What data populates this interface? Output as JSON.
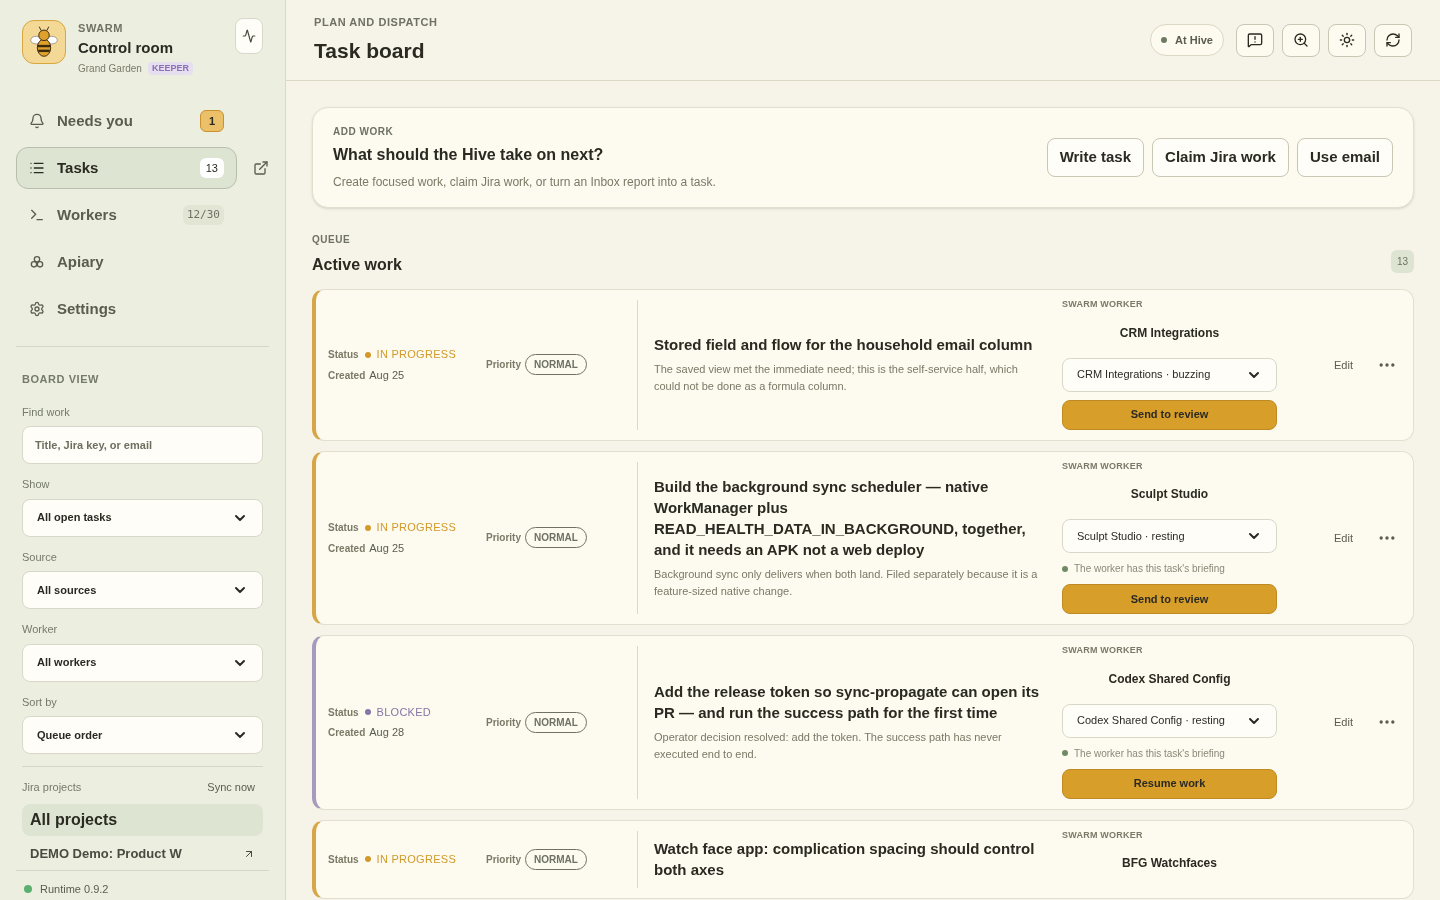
{
  "brand": {
    "eyebrow": "SWARM",
    "title": "Control room",
    "org": "Grand Garden",
    "role": "KEEPER"
  },
  "nav": [
    {
      "label": "Needs you",
      "badge": {
        "text": "1",
        "kind": "alert"
      },
      "selected": false
    },
    {
      "label": "Tasks",
      "badge": {
        "text": "13",
        "kind": "count"
      },
      "selected": true
    },
    {
      "label": "Workers",
      "badge": {
        "text": "12/30",
        "kind": "ratio"
      },
      "selected": false
    },
    {
      "label": "Apiary",
      "selected": false
    },
    {
      "label": "Settings",
      "selected": false
    }
  ],
  "board_view": {
    "heading": "BOARD VIEW",
    "search": {
      "label": "Find work",
      "placeholder": "Title, Jira key, or email"
    },
    "filters": [
      {
        "label": "Show",
        "value": "All open tasks"
      },
      {
        "label": "Source",
        "value": "All sources"
      },
      {
        "label": "Worker",
        "value": "All workers"
      },
      {
        "label": "Sort by",
        "value": "Queue order"
      }
    ],
    "jira": {
      "label": "Jira projects",
      "action": "Sync now"
    },
    "projects": [
      {
        "label": "All projects",
        "selected": true
      },
      {
        "label": "DEMO Demo: Product W",
        "selected": false
      }
    ]
  },
  "runtime": "Runtime 0.9.2",
  "header": {
    "eyebrow": "PLAN AND DISPATCH",
    "title": "Task board",
    "presence": "At Hive"
  },
  "add_work": {
    "eyebrow": "ADD WORK",
    "title": "What should the Hive take on next?",
    "description": "Create focused work, claim Jira work, or turn an Inbox report into a task.",
    "buttons": [
      "Write task",
      "Claim Jira work",
      "Use email"
    ]
  },
  "queue": {
    "eyebrow": "QUEUE",
    "title": "Active work",
    "count": "13"
  },
  "tasks": [
    {
      "status_label": "Status",
      "status": "IN PROGRESS",
      "kind": "in_progress",
      "priority_label": "Priority",
      "priority": "NORMAL",
      "created_label": "Created",
      "created": "Aug 25",
      "title": "Stored field and flow for the household email column",
      "description": "The saved view met the immediate need; this is the self-service half, which could not be done as a formula column.",
      "worker_label": "SWARM WORKER",
      "worker": "CRM Integrations",
      "assignee": "CRM Integrations · buzzing",
      "action": "Send to review",
      "edit": "Edit"
    },
    {
      "status_label": "Status",
      "status": "IN PROGRESS",
      "kind": "in_progress",
      "priority_label": "Priority",
      "priority": "NORMAL",
      "created_label": "Created",
      "created": "Aug 25",
      "title": "Build the background sync scheduler — native WorkManager plus READ_HEALTH_DATA_IN_BACKGROUND, together, and it needs an APK not a web deploy",
      "description": "Background sync only delivers when both land. Filed separately because it is a feature-sized native change.",
      "worker_label": "SWARM WORKER",
      "worker": "Sculpt Studio",
      "assignee": "Sculpt Studio · resting",
      "briefing": "The worker has this task's briefing",
      "action": "Send to review",
      "edit": "Edit"
    },
    {
      "status_label": "Status",
      "status": "BLOCKED",
      "kind": "blocked",
      "priority_label": "Priority",
      "priority": "NORMAL",
      "created_label": "Created",
      "created": "Aug 28",
      "title": "Add the release token so sync-propagate can open its PR — and run the success path for the first time",
      "description": "Operator decision resolved: add the token. The success path has never executed end to end.",
      "worker_label": "SWARM WORKER",
      "worker": "Codex Shared Config",
      "assignee": "Codex Shared Config · resting",
      "briefing": "The worker has this task's briefing",
      "action": "Resume work",
      "edit": "Edit"
    },
    {
      "status_label": "Status",
      "status": "IN PROGRESS",
      "kind": "in_progress",
      "priority_label": "Priority",
      "priority": "NORMAL",
      "title": "Watch face app: complication spacing should control both axes",
      "worker_label": "SWARM WORKER",
      "worker": "BFG Watchfaces"
    }
  ]
}
